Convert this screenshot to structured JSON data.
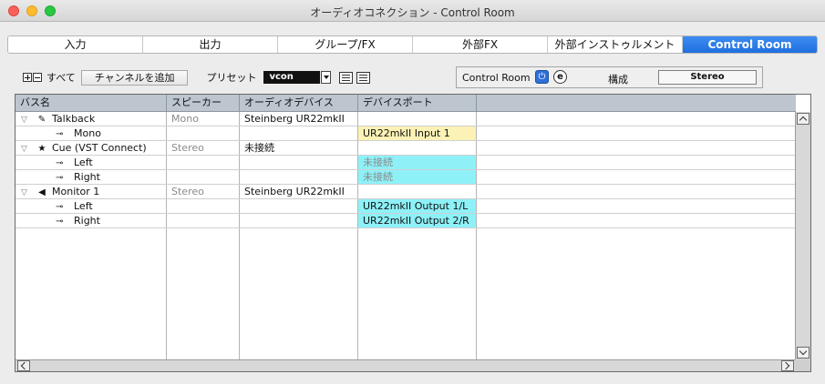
{
  "window": {
    "title": "オーディオコネクション - Control Room"
  },
  "tabs": [
    {
      "label": "入力",
      "active": false
    },
    {
      "label": "出力",
      "active": false
    },
    {
      "label": "グループ/FX",
      "active": false
    },
    {
      "label": "外部FX",
      "active": false
    },
    {
      "label": "外部インストゥルメント",
      "active": false
    },
    {
      "label": "Control Room",
      "active": true
    }
  ],
  "toolbar": {
    "all_label": "すべて",
    "add_channel_label": "チャンネルを追加",
    "preset_label": "プリセット",
    "preset_value": "vcon"
  },
  "control_room": {
    "label": "Control Room",
    "power_glyph": "⏻",
    "e_glyph": "e",
    "config_label": "構成",
    "config_value": "Stereo"
  },
  "table": {
    "columns": [
      "バス名",
      "スピーカー",
      "オーディオデバイス",
      "デバイスポート"
    ],
    "rows": [
      {
        "level": 0,
        "icon": "microphone-icon",
        "icon_glyph": "✎",
        "name": "Talkback",
        "speaker": "Mono",
        "device": "Steinberg UR22mkII",
        "port": "",
        "port_style": ""
      },
      {
        "level": 1,
        "icon": "connector-icon",
        "icon_glyph": "⊸",
        "name": "Mono",
        "speaker": "",
        "device": "",
        "port": "UR22mkII Input 1",
        "port_style": "yellow"
      },
      {
        "level": 0,
        "icon": "star-icon",
        "icon_glyph": "★",
        "name": "Cue (VST Connect)",
        "speaker": "Stereo",
        "device": "未接続",
        "port": "",
        "port_style": ""
      },
      {
        "level": 1,
        "icon": "connector-icon",
        "icon_glyph": "⊸",
        "name": "Left",
        "speaker": "",
        "device": "",
        "port": "未接続",
        "port_style": "cyan-grey"
      },
      {
        "level": 1,
        "icon": "connector-icon",
        "icon_glyph": "⊸",
        "name": "Right",
        "speaker": "",
        "device": "",
        "port": "未接続",
        "port_style": "cyan-grey"
      },
      {
        "level": 0,
        "icon": "speaker-icon",
        "icon_glyph": "◀",
        "name": "Monitor 1",
        "speaker": "Stereo",
        "device": "Steinberg UR22mkII",
        "port": "",
        "port_style": ""
      },
      {
        "level": 1,
        "icon": "connector-icon",
        "icon_glyph": "⊸",
        "name": "Left",
        "speaker": "",
        "device": "",
        "port": "UR22mkII Output 1/L",
        "port_style": "cyan"
      },
      {
        "level": 1,
        "icon": "connector-icon",
        "icon_glyph": "⊸",
        "name": "Right",
        "speaker": "",
        "device": "",
        "port": "UR22mkII Output 2/R",
        "port_style": "cyan"
      }
    ]
  },
  "colors": {
    "accent": "#1f6fe0",
    "header_bg": "#bdc6cf",
    "port_yellow": "#fdf2b5",
    "port_cyan": "#8ef1f8"
  }
}
